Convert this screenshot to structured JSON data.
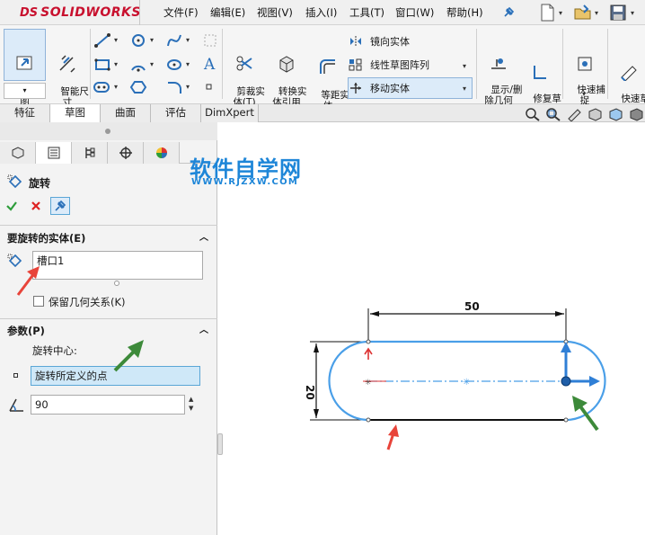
{
  "app": {
    "logo_prefix": "DS",
    "logo_name": "SOLIDWORKS"
  },
  "menu": [
    "文件(F)",
    "编辑(E)",
    "视图(V)",
    "插入(I)",
    "工具(T)",
    "窗口(W)",
    "帮助(H)"
  ],
  "toolbar": {
    "exit_sketch": "退出草\n图",
    "smart_dim": "智能尺\n寸",
    "trim": "剪裁实\n体(T)",
    "convert": "转换实\n体引用",
    "offset": "等距实\n体",
    "mirror": "镜向实体",
    "linear_pattern": "线性草图阵列",
    "move": "移动实体",
    "show_delete": "显示/删\n除几何\n关系",
    "repair": "修复草\n图",
    "quick_snap": "快速捕\n捉",
    "quick_sketch": "快速草\n图"
  },
  "tabs": [
    "特征",
    "草图",
    "曲面",
    "评估",
    "DimXpert"
  ],
  "active_tab": "草图",
  "panel": {
    "title": "旋转",
    "section_entities": "要旋转的实体(E)",
    "selected_entity": "槽口1",
    "keep_relations": "保留几何关系(K)",
    "section_params": "参数(P)",
    "rotation_center_label": "旋转中心:",
    "rotation_center_value": "旋转所定义的点",
    "angle": "90"
  },
  "watermark": {
    "title": "软件自学网",
    "url": "WWW.RJZXW.COM"
  },
  "sketch": {
    "dim_width": "50",
    "dim_height": "20"
  },
  "colors": {
    "sketch_blue": "#4a9fe8",
    "arrow_red": "#e8443a",
    "arrow_green": "#3d8a3a",
    "accent": "#c8102e"
  }
}
